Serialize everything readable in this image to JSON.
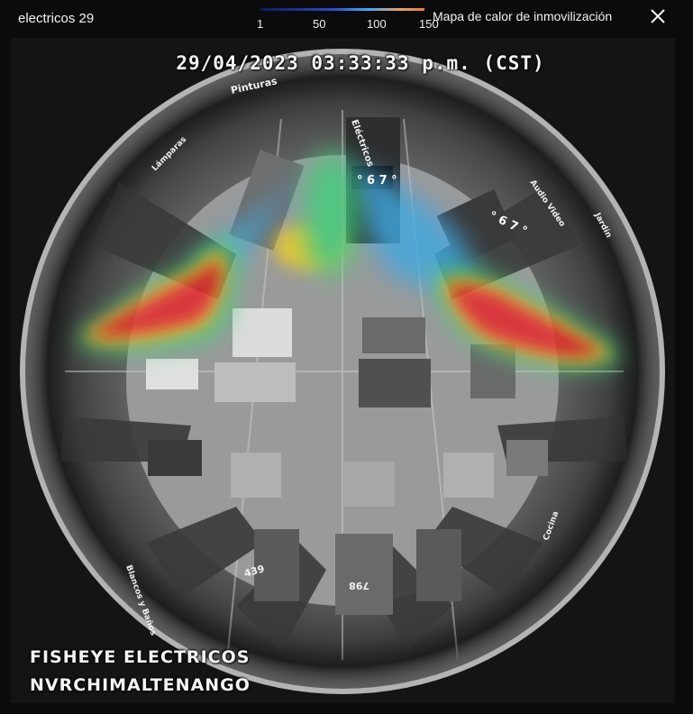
{
  "header": {
    "camera_title": "electricos 29",
    "heatmap_title": "Mapa de calor de inmovilización",
    "close_icon": "close-icon"
  },
  "legend": {
    "ticks": [
      "1",
      "50",
      "100",
      "150"
    ],
    "gradient_colors": [
      "#0d1a5c",
      "#2a4bd7",
      "#3fa8ff",
      "#e8a36a",
      "#f07a3c"
    ]
  },
  "video": {
    "timestamp": "29/04/2023 03:33:33 p.m. (CST)",
    "camera_name": "FISHEYE ELECTRICOS",
    "nvr_name": "NVRCHIMALTENANGO",
    "signs": {
      "pinturas": "Pinturas",
      "electricos": "Eléctricos",
      "audio_video": "Audio Video",
      "jardin": "Jardín",
      "lamparas": "Lámparas",
      "price_a": "° 6 7 °",
      "price_b": "° 6 7 °",
      "price_c": "439",
      "price_d": "798",
      "blancos": "Blancos y Baños",
      "cocina": "Cocina"
    },
    "heat_colors": {
      "hot": "#e8202a",
      "warm": "#f0d020",
      "mid": "#3fd07a",
      "cool": "#3fa8e0"
    }
  }
}
